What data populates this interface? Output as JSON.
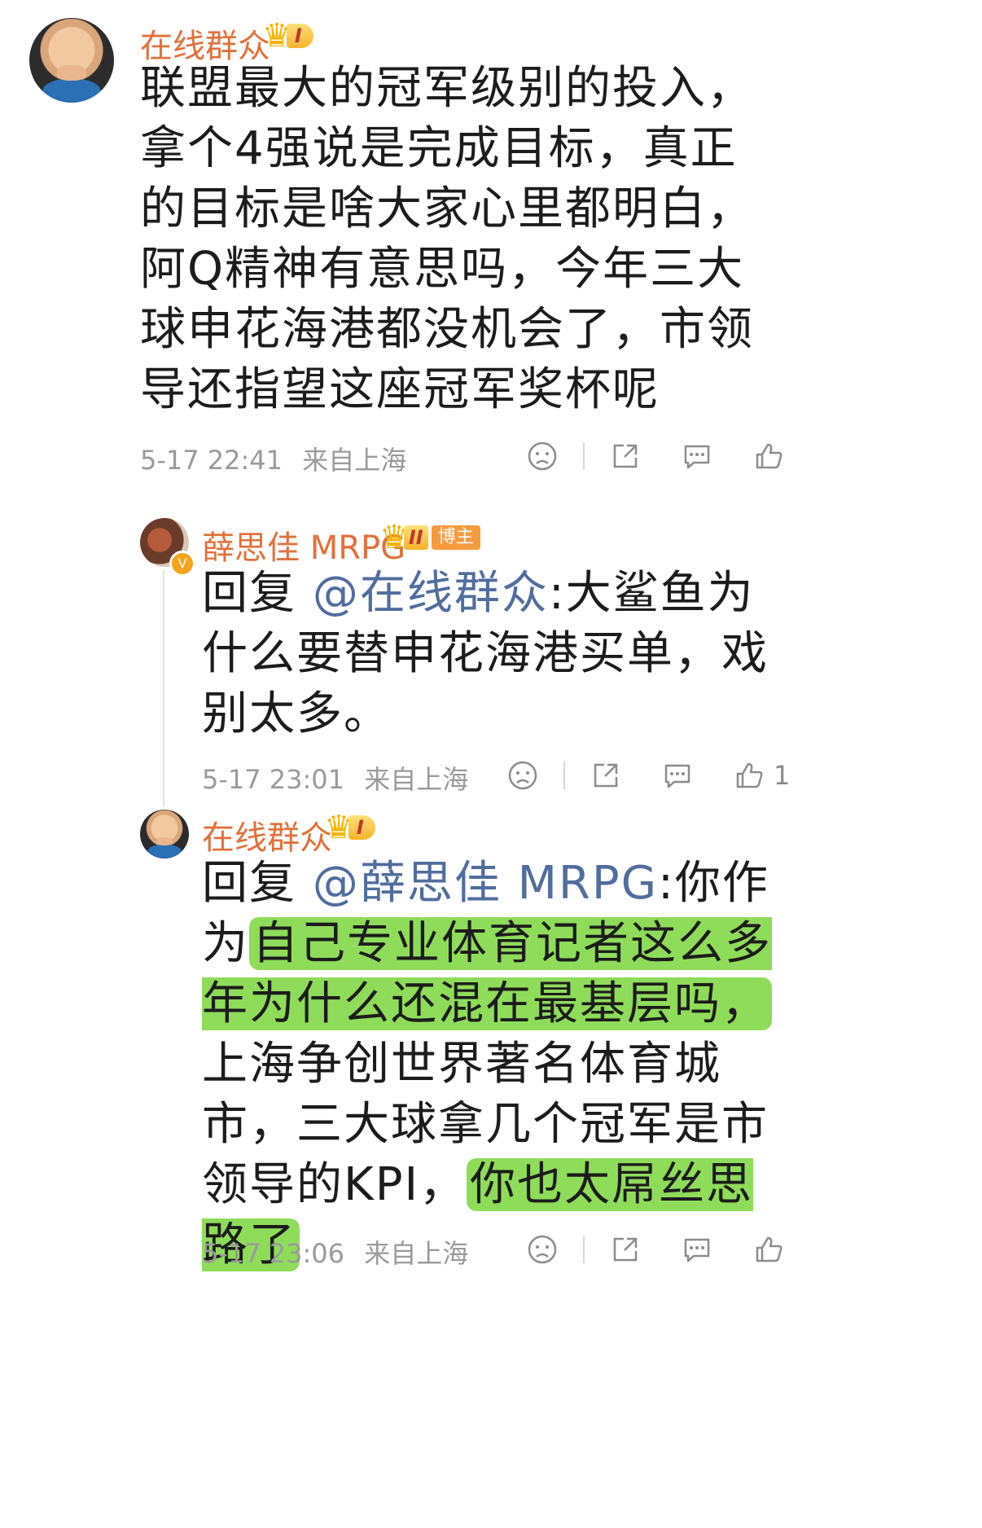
{
  "comment": {
    "username": "在线群众",
    "level": "I",
    "text": "联盟最大的冠军级别的投入，拿个4强说是完成目标，真正的目标是啥大家心里都明白，阿Q精神有意思吗，今年三大球申花海港都没机会了，市领导还指望这座冠军奖杯呢",
    "time": "5-17 22:41",
    "location": "来自上海"
  },
  "reply1": {
    "username": "薛思佳 MRPG",
    "level": "II",
    "badge": "博主",
    "prefix": "回复 ",
    "mention": "@在线群众",
    "text": ":大鲨鱼为什么要替申花海港买单，戏别太多。",
    "time": "5-17 23:01",
    "location": "来自上海",
    "like_count": "1"
  },
  "reply2": {
    "username": "在线群众",
    "level": "I",
    "prefix": "回复 ",
    "mention": "@薛思佳 MRPG",
    "text_a": ":你作为",
    "text_hl1": "自己专业体育记者这么多年为什么还混在最基层吗，",
    "text_b": "上海争创世界著名体育城市，三大球拿几个冠军是市领导的KPI，",
    "text_hl2": "你也太屌丝思路了",
    "time": "5-17 23:06",
    "location": "来自上海"
  },
  "colors": {
    "username": "#e2703a",
    "mention": "#516d9e",
    "highlight": "#8fdc5a",
    "meta": "#9a9a9a"
  },
  "icons": [
    "dislike-icon",
    "share-icon",
    "comment-icon",
    "like-icon"
  ]
}
